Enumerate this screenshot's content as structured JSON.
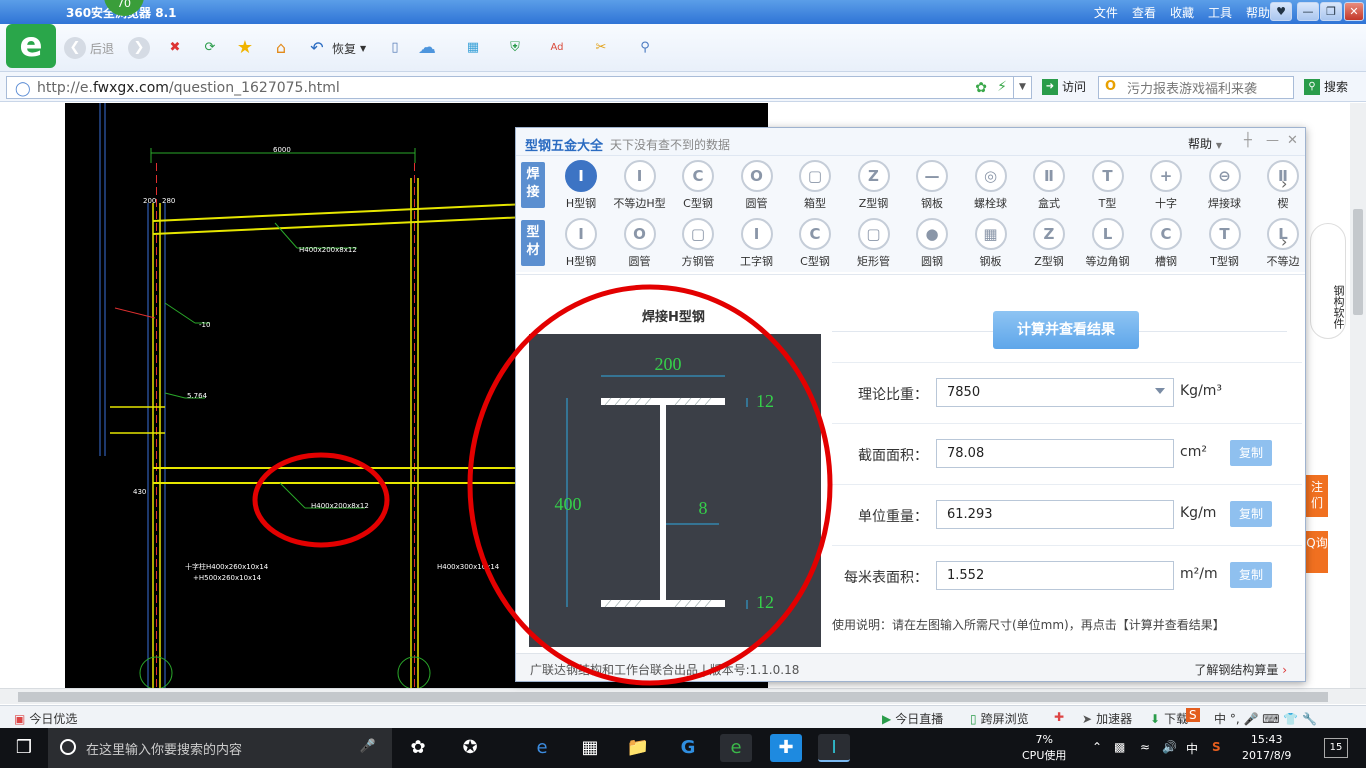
{
  "browser": {
    "title": "360安全浏览器 8.1",
    "badge": "70",
    "menu": [
      "文件",
      "查看",
      "收藏",
      "工具",
      "帮助"
    ],
    "back_label": "后退",
    "restore_label": "恢复",
    "url_prefix": "http://e.",
    "url_domain": "fwxgx.com",
    "url_path": "/question_1627075.html",
    "visit_label": "访问",
    "search_placeholder": "污力报表游戏福利来袭",
    "search_button": "搜索"
  },
  "cad": {
    "dim_6000": "6000",
    "dim_200": "200",
    "dim_280": "280",
    "label_beam1": "H400x200x8x12",
    "label_beam2": "H400x200x8x12",
    "label_neg10": "-10",
    "label_5764": "5.764",
    "label_430": "430",
    "label_col1": "十字柱H400x260x10x14",
    "label_col2": "+H500x260x10x14",
    "label_col3": "H400x300x10x14"
  },
  "dialog": {
    "app_name": "型钢五金大全",
    "tagline": "天下没有查不到的数据",
    "help": "帮助",
    "row1_label": "焊接",
    "row2_label": "型材",
    "row1_items": [
      "H型钢",
      "不等边H型",
      "C型钢",
      "圆管",
      "箱型",
      "Z型钢",
      "钢板",
      "螺栓球",
      "盒式",
      "T型",
      "十字",
      "焊接球",
      "楔"
    ],
    "row1_icons": [
      "I",
      "I",
      "C",
      "O",
      "▢",
      "Z",
      "—",
      "◎",
      "Ⅱ",
      "T",
      "+",
      "⊖",
      "Ⅱ"
    ],
    "row2_items": [
      "H型钢",
      "圆管",
      "方钢管",
      "工字钢",
      "C型钢",
      "矩形管",
      "圆钢",
      "钢板",
      "Z型钢",
      "等边角钢",
      "槽钢",
      "T型钢",
      "不等边"
    ],
    "row2_icons": [
      "I",
      "O",
      "▢",
      "I",
      "C",
      "▢",
      "●",
      "▦",
      "Z",
      "L",
      "C",
      "T",
      "L"
    ],
    "diagram_title": "焊接H型钢",
    "dims": {
      "width": "200",
      "height": "400",
      "web": "8",
      "flange_top": "12",
      "flange_bottom": "12"
    },
    "calc_button": "计算并查看结果",
    "fields": [
      {
        "label": "理论比重：",
        "value": "7850",
        "unit": "Kg/m³",
        "dropdown": true
      },
      {
        "label": "截面面积：",
        "value": "78.08",
        "unit": "cm²",
        "copy": "复制"
      },
      {
        "label": "单位重量：",
        "value": "61.293",
        "unit": "Kg/m",
        "copy": "复制"
      },
      {
        "label": "每米表面积：",
        "value": "1.552",
        "unit": "m²/m",
        "copy": "复制"
      }
    ],
    "usage": "使用说明：请在左图输入所需尺寸(单位mm)，再点击【计算并查看结果】",
    "footer_left": "广联达钢结构和工作台联合出品  |  版本号:1.1.0.18",
    "footer_right": "了解钢结构算量"
  },
  "side_strip": {
    "mascot": "钢构软件",
    "btn1": "注们",
    "btn2": "Q询"
  },
  "statusbar": {
    "left": "今日优选",
    "live": "今日直播",
    "cross": "跨屏浏览",
    "accel": "加速器",
    "download": "下载"
  },
  "taskbar": {
    "search_placeholder": "在这里输入你要搜索的内容",
    "cpu_value": "7%",
    "cpu_label": "CPU使用",
    "ime": "中",
    "time": "15:43",
    "date": "2017/8/9",
    "notif_count": "15"
  },
  "colors": {
    "accent": "#3d74c4",
    "annotation": "#e30000",
    "cad_bg": "#000000",
    "cad_yellow": "#e6e600",
    "diagram_bg": "#3b3f47"
  }
}
